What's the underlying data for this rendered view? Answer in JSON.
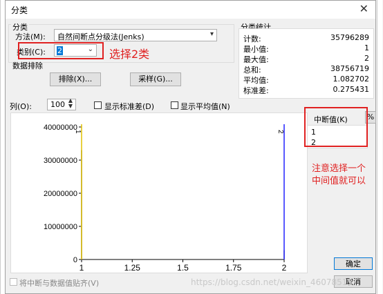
{
  "window": {
    "title": "分类",
    "close": "✕"
  },
  "classify": {
    "group_label": "分类",
    "method_label": "方法(M):",
    "method_value": "自然间断点分级法(Jenks)",
    "classes_label": "类别(C):",
    "classes_value": "2"
  },
  "sampling": {
    "group_label": "数据排除",
    "exclude_button": "排除(X)...",
    "sample_button": "采样(G)..."
  },
  "stats": {
    "group_label": "分类统计",
    "rows": [
      {
        "label": "计数:",
        "value": "35796289"
      },
      {
        "label": "最小值:",
        "value": "1"
      },
      {
        "label": "最大值:",
        "value": "2"
      },
      {
        "label": "总和:",
        "value": "38756719"
      },
      {
        "label": "平均值:",
        "value": "1.082702"
      },
      {
        "label": "标准差:",
        "value": "0.275431"
      }
    ]
  },
  "columns": {
    "label": "列(O):",
    "value": "100",
    "show_std": "显示标准差(D)",
    "show_mean": "显示平均值(N)"
  },
  "breaks": {
    "label": "中断值(K)",
    "percent_button": "%",
    "values": [
      "1",
      "2"
    ]
  },
  "annotations": {
    "select_classes": "选择2类",
    "select_middle_line1": "注意选择一个",
    "select_middle_line2": "中间值就可以"
  },
  "footer": {
    "snap_label": "将中断与数据值贴齐(V)",
    "ok": "确定",
    "cancel": "取消",
    "watermark": "https://blog.csdn.net/weixin_46078515"
  },
  "colors": {
    "annotation": "#e02020",
    "break_line_1": "#e0c000",
    "break_line_2": "#2020ff"
  },
  "chart_data": {
    "type": "bar",
    "x": [
      1,
      2
    ],
    "values": [
      33000000,
      2800000
    ],
    "xlim": [
      1,
      2
    ],
    "ylim": [
      0,
      40000000
    ],
    "xticks": [
      "1",
      "1.25",
      "1.5",
      "1.75",
      "2"
    ],
    "yticks": [
      "0",
      "10000000",
      "20000000",
      "30000000",
      "40000000"
    ],
    "break_markers": [
      "1",
      "2"
    ]
  }
}
